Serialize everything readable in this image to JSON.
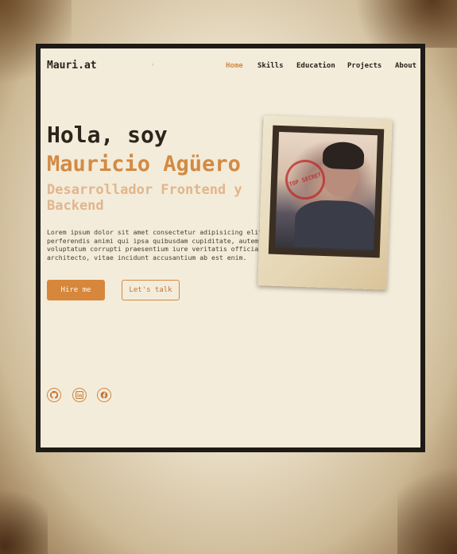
{
  "nav": {
    "logo": "Mauri.at",
    "dot": "◦",
    "links": [
      "Home",
      "Skills",
      "Education",
      "Projects",
      "About"
    ],
    "active_index": 0
  },
  "hero": {
    "greeting": "Hola, soy",
    "name": "Mauricio Agüero",
    "role": "Desarrollador Frontend y Backend",
    "lorem": "Lorem ipsum dolor sit amet consectetur adipisicing elit. S\nperferendis animi qui ipsa quibusdam cupiditate, autem\nvoluptatum corrupti praesentium iure veritatis officia ame\narchitecto, vitae incidunt accusantium ab est enim.",
    "hire_label": "Hire me",
    "talk_label": "Let's talk"
  },
  "social": {
    "icons": [
      "github-icon",
      "linkedin-icon",
      "facebook-icon"
    ]
  },
  "photo": {
    "stamp_text": "TOP SECRET"
  },
  "colors": {
    "accent": "#d6873c",
    "background": "#f3ecdb",
    "text": "#2e241c"
  }
}
